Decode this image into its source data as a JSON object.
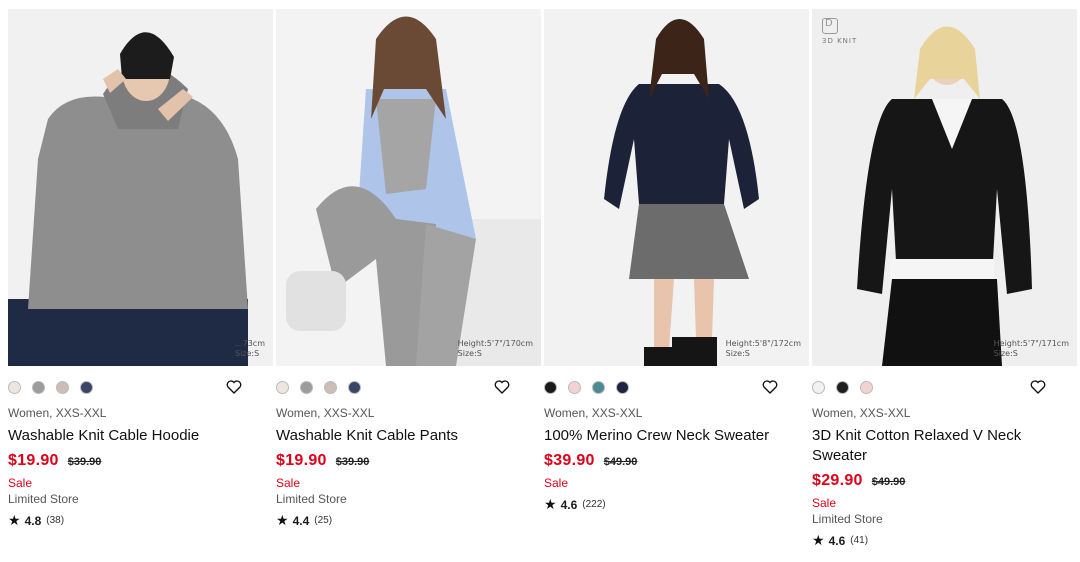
{
  "products": [
    {
      "colors": [
        "#ece6df",
        "#9c9c9c",
        "#cdbdb6",
        "#3a4668"
      ],
      "gender_sizes": "Women, XXS-XXL",
      "name": "Washable Knit Cable Hoodie",
      "price": "$19.90",
      "original_price": "$39.90",
      "sale_label": "Sale",
      "store_label": "Limited Store",
      "rating": "4.8",
      "reviews": "(38)",
      "size_note": [
        "...73cm",
        "Size:S"
      ]
    },
    {
      "colors": [
        "#ece6df",
        "#9c9c9c",
        "#cdbdb6",
        "#3a4668"
      ],
      "gender_sizes": "Women, XXS-XXL",
      "name": "Washable Knit Cable Pants",
      "price": "$19.90",
      "original_price": "$39.90",
      "sale_label": "Sale",
      "store_label": "Limited Store",
      "rating": "4.4",
      "reviews": "(25)",
      "size_note": [
        "Height:5'7\"/170cm",
        "Size:S"
      ]
    },
    {
      "colors": [
        "#1a1a1a",
        "#f3d3d0",
        "#4b8b93",
        "#1d2440"
      ],
      "gender_sizes": "Women, XXS-XXL",
      "name": "100% Merino Crew Neck Sweater",
      "price": "$39.90",
      "original_price": "$49.90",
      "sale_label": "Sale",
      "store_label": "",
      "rating": "4.6",
      "reviews": "(222)",
      "size_note": [
        "Height:5'8\"/172cm",
        "Size:S"
      ]
    },
    {
      "colors": [
        "#f2f2f2",
        "#1f1f1f",
        "#f3d3d0"
      ],
      "gender_sizes": "Women, XXS-XXL",
      "name": "3D Knit Cotton Relaxed V Neck Sweater",
      "price": "$29.90",
      "original_price": "$49.90",
      "sale_label": "Sale",
      "store_label": "Limited Store",
      "rating": "4.6",
      "reviews": "(41)",
      "size_note": [
        "Height:5'7\"/171cm",
        "Size:S"
      ],
      "badge": "3D KNIT"
    }
  ],
  "icons": {
    "favorite": "heart-icon",
    "rating": "star-icon"
  }
}
